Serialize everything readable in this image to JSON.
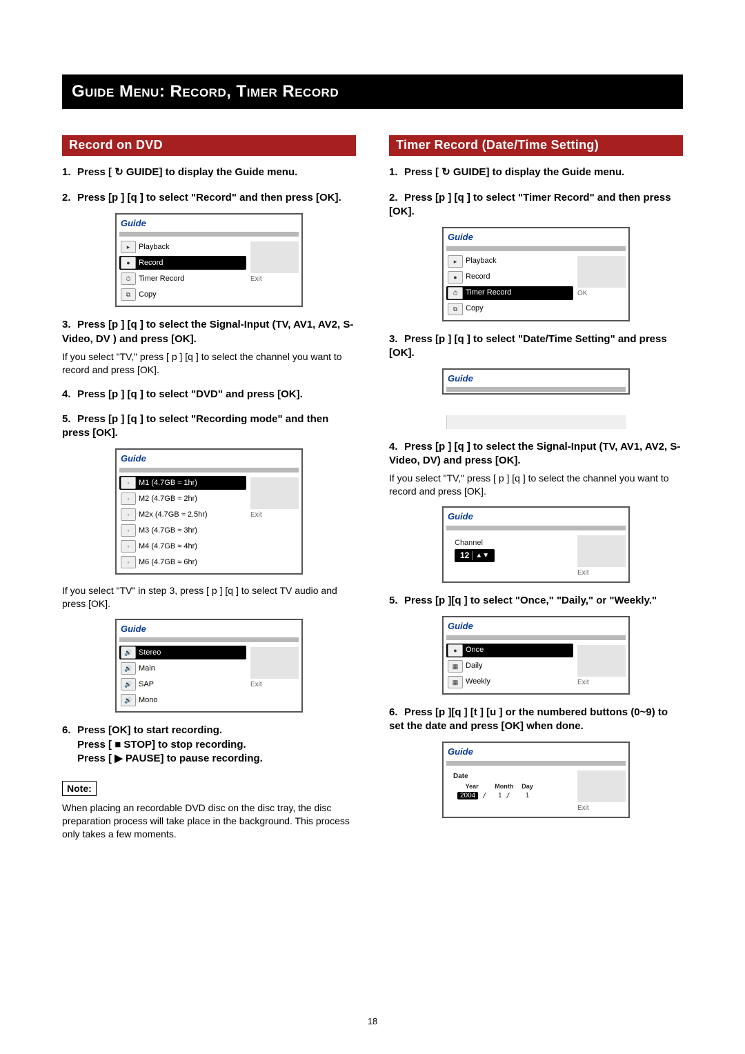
{
  "page_number": "18",
  "title": "Guide Menu: Record, Timer Record",
  "left": {
    "heading": "Record on DVD",
    "steps": {
      "s1": "Press [ ↻ GUIDE] to display the Guide menu.",
      "s2": "Press [p ]  [q ] to select \"Record\" and then press [OK].",
      "s3": "Press [p ]  [q ] to select the Signal-Input (TV, AV1, AV2, S-Video, DV ) and press [OK].",
      "s3note": "If you select \"TV,\" press [ p ] [q ] to select the channel you want to record and press [OK].",
      "s4": "Press [p ]  [q ] to select \"DVD\" and press [OK].",
      "s5": "Press [p ]  [q ] to select \"Recording mode\" and then press [OK].",
      "s5note": "If you select \"TV\" in step 3, press [ p ] [q ] to select TV audio and press [OK].",
      "s6a": "Press [OK] to start recording.",
      "s6b": "Press [ ■ STOP] to stop recording.",
      "s6c": "Press [ ▶ PAUSE] to pause recording."
    },
    "note_label": "Note:",
    "note_text": "When placing an recordable DVD disc on the disc tray, the disc preparation process will take place in the background. This process only takes a few moments.",
    "osd": {
      "title": "Guide",
      "exit": "Exit",
      "menu1": {
        "playback": "Playback",
        "record": "Record",
        "timer": "Timer Record",
        "copy": "Copy"
      },
      "modes": {
        "m1": "M1  (4.7GB  ≈ 1hr)",
        "m2": "M2  (4.7GB  ≈ 2hr)",
        "m2x": "M2x (4.7GB  ≈ 2.5hr)",
        "m3": "M3  (4.7GB  ≈ 3hr)",
        "m4": "M4  (4.7GB  ≈ 4hr)",
        "m6": "M6  (4.7GB  ≈ 6hr)"
      },
      "audio": {
        "stereo": "Stereo",
        "main": "Main",
        "sap": "SAP",
        "mono": "Mono"
      }
    }
  },
  "right": {
    "heading": "Timer Record (Date/Time Setting)",
    "steps": {
      "s1": "Press [ ↻ GUIDE] to display the Guide menu.",
      "s2": "Press [p ]  [q ] to select \"Timer Record\" and then press [OK].",
      "s3": "Press [p ] [q ] to select \"Date/Time Setting\" and press [OK].",
      "s4": "Press [p ]  [q ] to select the Signal-Input (TV, AV1, AV2, S-Video, DV) and press [OK].",
      "s4note": "If you select \"TV,\" press [ p ] [q ] to select the channel you want to record and press [OK].",
      "s5": "Press [p ][q ] to select \"Once,\" \"Daily,\" or \"Weekly.\"",
      "s6": "Press [p ][q ] [t ] [u ] or the numbered buttons (0~9) to set the date and press [OK] when done."
    },
    "osd": {
      "title": "Guide",
      "exit": "Exit",
      "ok": "OK",
      "menu1": {
        "playback": "Playback",
        "record": "Record",
        "timer": "Timer Record",
        "copy": "Copy"
      },
      "channel": {
        "label": "Channel",
        "value": "12"
      },
      "freq": {
        "once": "Once",
        "daily": "Daily",
        "weekly": "Weekly"
      },
      "date": {
        "label": "Date",
        "year_h": "Year",
        "month_h": "Month",
        "day_h": "Day",
        "year_v": "2004",
        "month_v": "1",
        "day_v": "1"
      }
    }
  }
}
